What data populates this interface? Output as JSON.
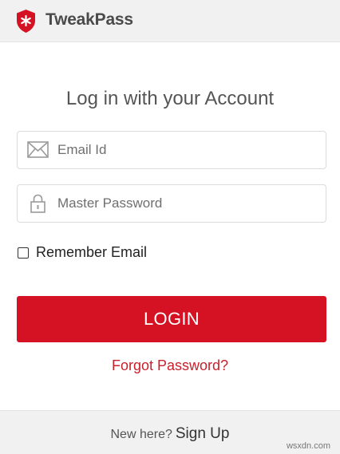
{
  "app": {
    "name": "TweakPass",
    "brand_color": "#d41224"
  },
  "icons": {
    "logo": "tweakpass-shield-icon",
    "email": "envelope-icon",
    "password": "lock-icon"
  },
  "login": {
    "title": "Log in with your Account",
    "email_placeholder": "Email Id",
    "email_value": "",
    "password_placeholder": "Master Password",
    "password_value": "",
    "remember_label": "Remember Email",
    "remember_checked": false,
    "submit_label": "LOGIN",
    "forgot_label": "Forgot Password?"
  },
  "footer": {
    "prompt": "New here?",
    "signup_label": "Sign Up"
  },
  "watermark": "wsxdn.com"
}
